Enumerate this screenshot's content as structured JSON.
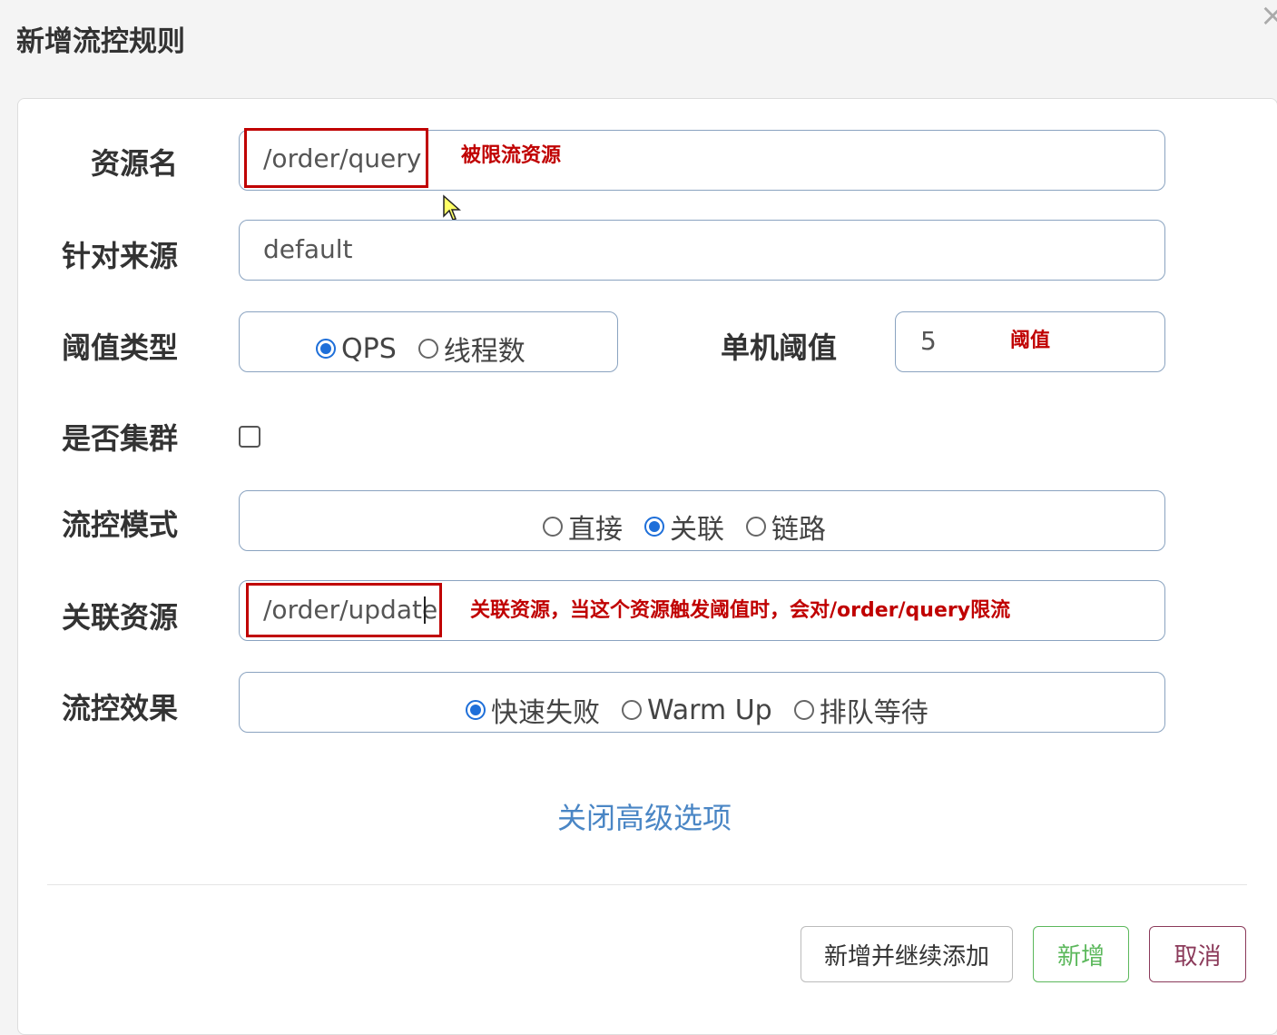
{
  "dialog": {
    "title": "新增流控规则",
    "close_glyph": "×"
  },
  "form": {
    "resource": {
      "label": "资源名",
      "value": "/order/query",
      "note": "被限流资源"
    },
    "origin": {
      "label": "针对来源",
      "value": "default"
    },
    "threshold_type": {
      "label": "阈值类型",
      "options": [
        "QPS",
        "线程数"
      ],
      "selected": "QPS"
    },
    "single_threshold": {
      "label": "单机阈值",
      "value": "5",
      "note": "阈值"
    },
    "cluster": {
      "label": "是否集群",
      "checked": false
    },
    "mode": {
      "label": "流控模式",
      "options": [
        "直接",
        "关联",
        "链路"
      ],
      "selected": "关联"
    },
    "related_resource": {
      "label": "关联资源",
      "value": "/order/update",
      "note": "关联资源，当这个资源触发阈值时，会对/order/query限流"
    },
    "effect": {
      "label": "流控效果",
      "options": [
        "快速失败",
        "Warm Up",
        "排队等待"
      ],
      "selected": "快速失败"
    },
    "advanced_link": "关闭高级选项"
  },
  "footer": {
    "add_continue": "新增并继续添加",
    "add": "新增",
    "cancel": "取消"
  },
  "colors": {
    "accent": "#1e6fd9",
    "annotation": "#c00000",
    "link": "#4a86c5",
    "add_button": "#5cb85c",
    "cancel_button": "#8b3a5a"
  }
}
